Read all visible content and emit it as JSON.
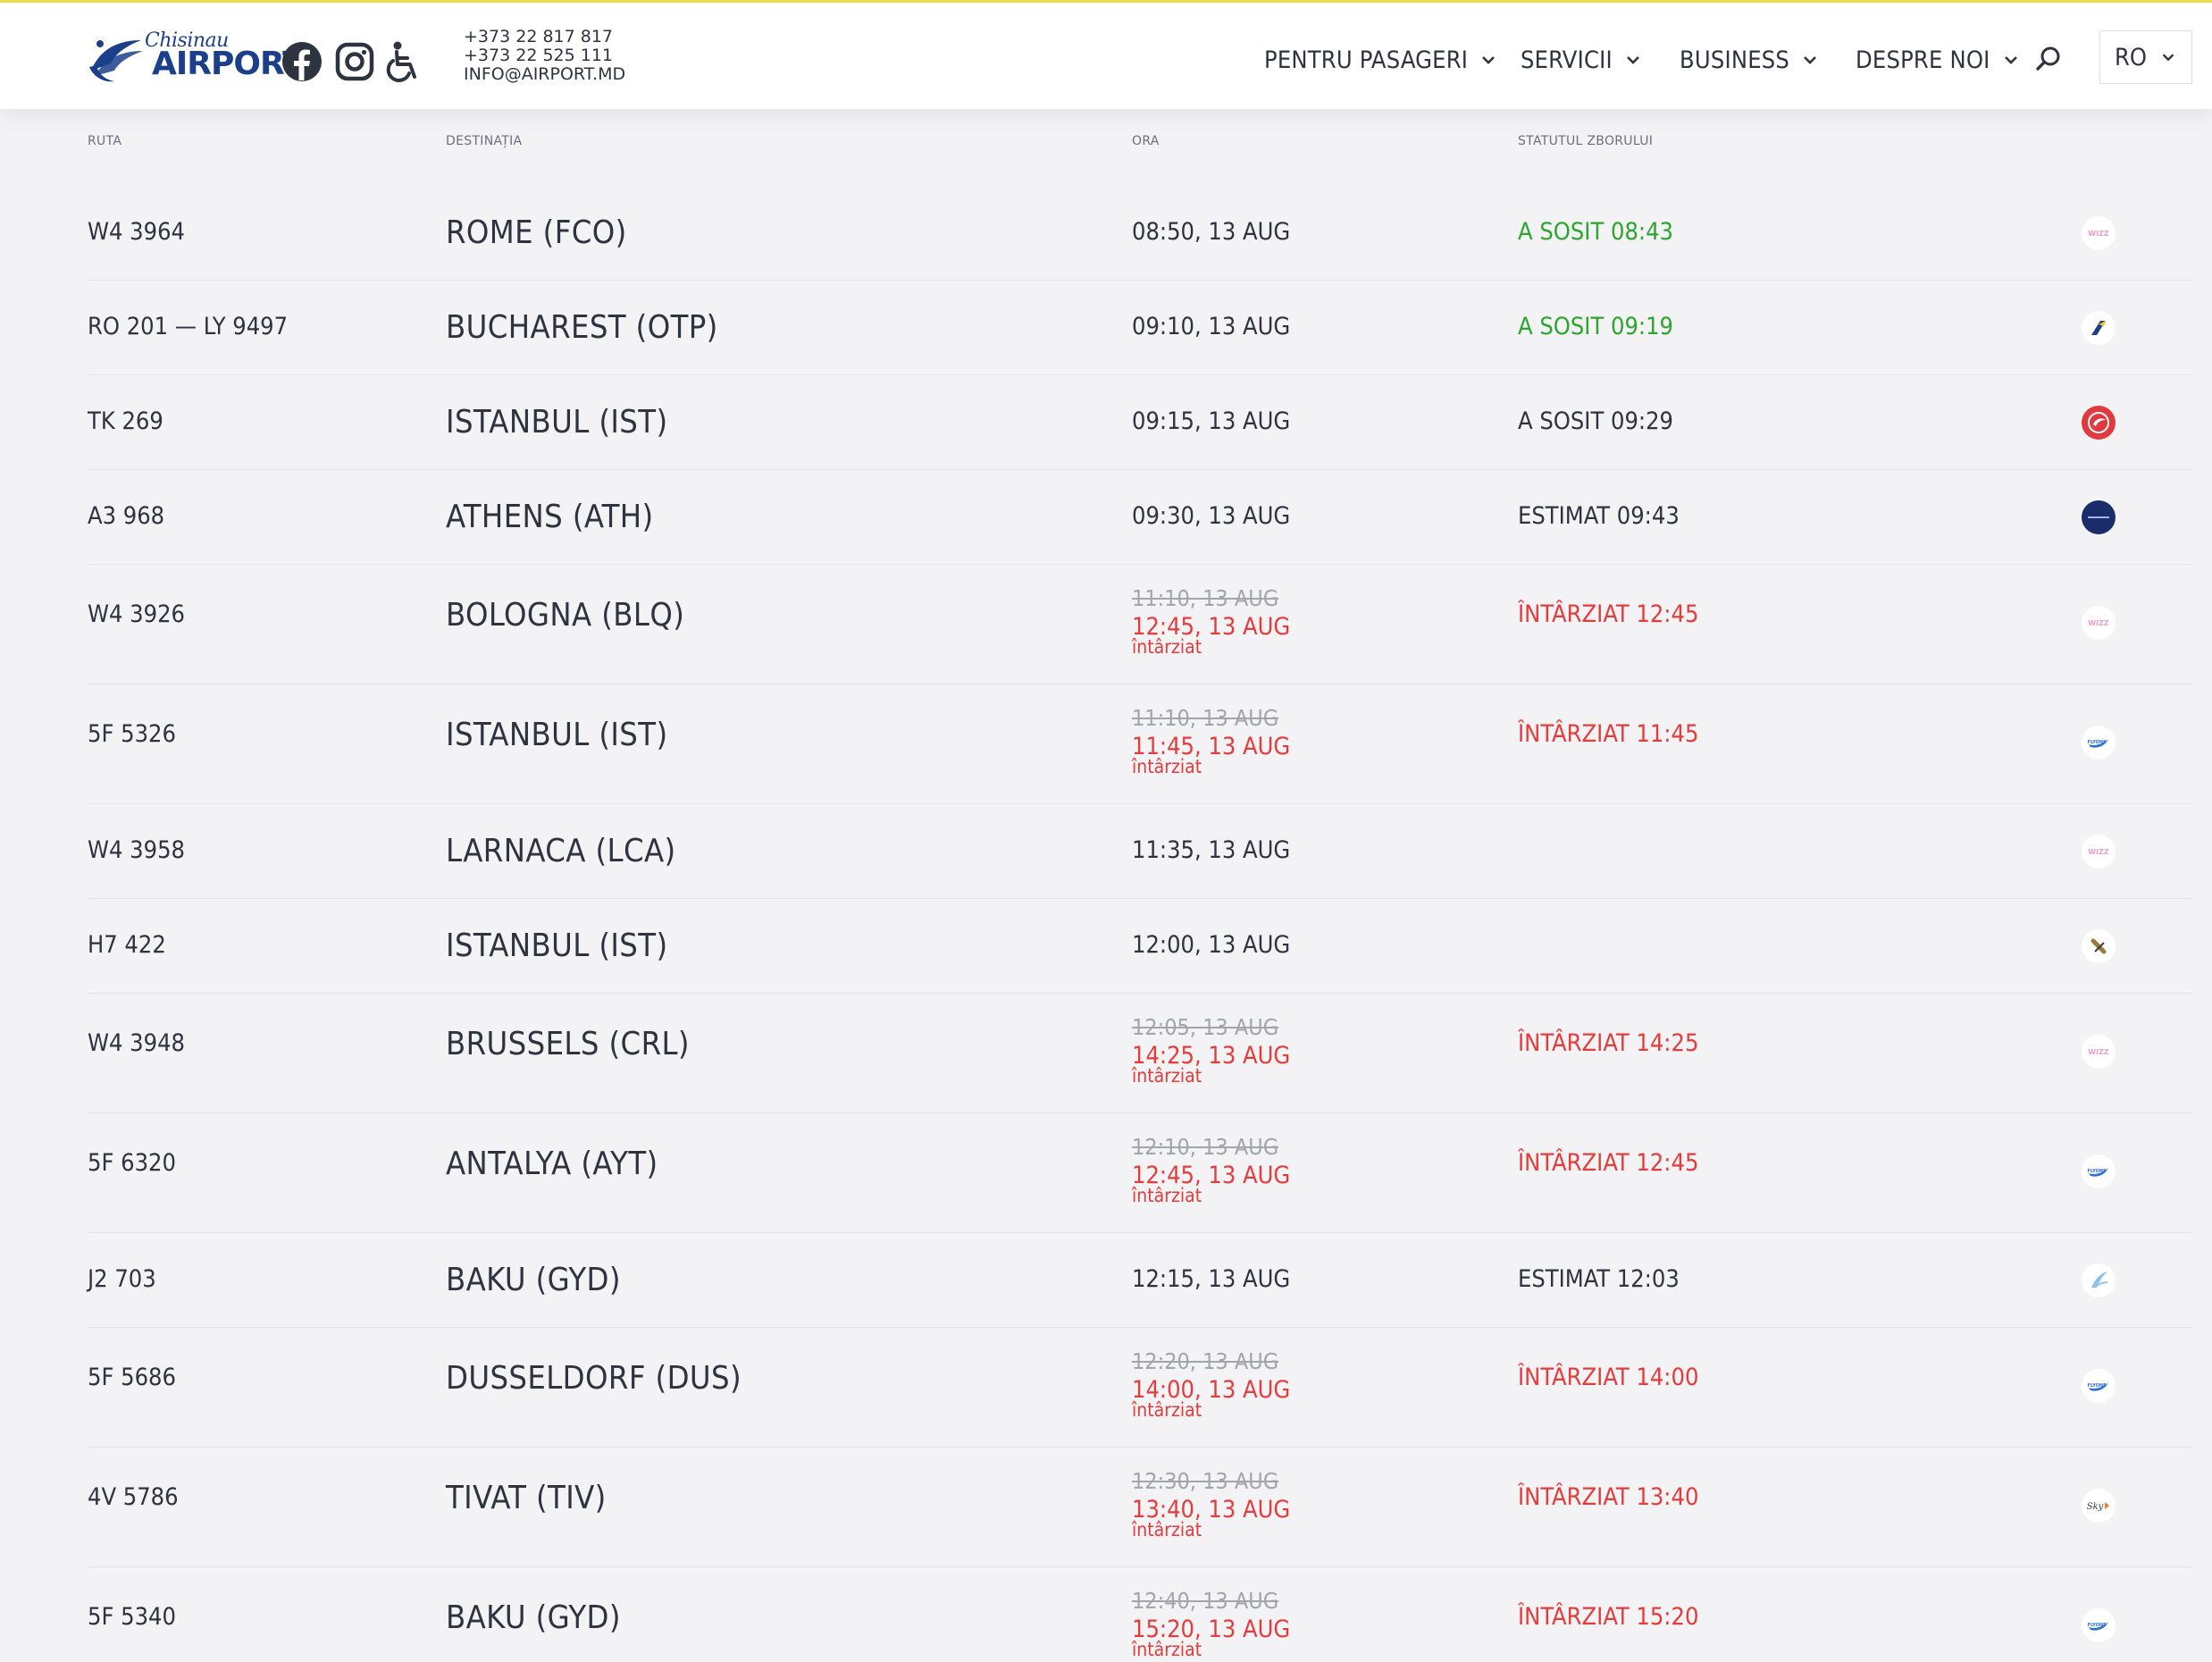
{
  "header": {
    "logo": {
      "city": "Chisinau",
      "word": "AIRPORT"
    },
    "social": {
      "facebook_icon": "facebook-icon",
      "instagram_icon": "instagram-icon",
      "accessibility_icon": "wheelchair-icon"
    },
    "contacts": {
      "phone_1": "+373 22 817 817",
      "phone_2": "+373 22 525 111",
      "email": "INFO@AIRPORT.MD"
    },
    "nav": [
      {
        "label": "PENTRU PASAGERI"
      },
      {
        "label": "SERVICII"
      },
      {
        "label": "BUSINESS"
      },
      {
        "label": "DESPRE NOI"
      }
    ],
    "search_icon": "search-icon",
    "language": "RO"
  },
  "table": {
    "columns": {
      "route": "RUTA",
      "destination": "DESTINAȚIA",
      "time": "ORA",
      "status": "STATUTUL ZBORULUI"
    },
    "rows": [
      {
        "route": "W4 3964",
        "destination": "ROME (FCO)",
        "time": "08:50, 13 AUG",
        "status": "A SOSIT 08:43",
        "status_type": "arrived",
        "airline_icon": "wizz-air-logo"
      },
      {
        "route": "RO 201 — LY 9497",
        "destination": "BUCHAREST (OTP)",
        "time": "09:10, 13 AUG",
        "status": "A SOSIT 09:19",
        "status_type": "arrived",
        "airline_icon": "tarom-logo"
      },
      {
        "route": "TK 269",
        "destination": "ISTANBUL (IST)",
        "time": "09:15, 13 AUG",
        "status": "A SOSIT 09:29",
        "status_type": "arrived-plain",
        "airline_icon": "turkish-airlines-logo"
      },
      {
        "route": "A3 968",
        "destination": "ATHENS (ATH)",
        "time": "09:30, 13 AUG",
        "status": "ESTIMAT 09:43",
        "status_type": "estimated",
        "airline_icon": "aegean-logo"
      },
      {
        "route": "W4 3926",
        "destination": "BOLOGNA (BLQ)",
        "time": "11:10, 13 AUG",
        "new_time": "12:45, 13 AUG",
        "delay_label": "întârziat",
        "status": "ÎNTÂRZIAT 12:45",
        "status_type": "delayed",
        "airline_icon": "wizz-air-logo"
      },
      {
        "route": "5F 5326",
        "destination": "ISTANBUL (IST)",
        "time": "11:10, 13 AUG",
        "new_time": "11:45, 13 AUG",
        "delay_label": "întârziat",
        "status": "ÎNTÂRZIAT 11:45",
        "status_type": "delayed",
        "airline_icon": "fly-one-logo"
      },
      {
        "route": "W4 3958",
        "destination": "LARNACA (LCA)",
        "time": "11:35, 13 AUG",
        "status": "",
        "status_type": "none",
        "airline_icon": "wizz-air-logo"
      },
      {
        "route": "H7 422",
        "destination": "ISTANBUL (IST)",
        "time": "12:00, 13 AUG",
        "status": "",
        "status_type": "none",
        "airline_icon": "hisky-logo"
      },
      {
        "route": "W4 3948",
        "destination": "BRUSSELS (CRL)",
        "time": "12:05, 13 AUG",
        "new_time": "14:25, 13 AUG",
        "delay_label": "întârziat",
        "status": "ÎNTÂRZIAT 14:25",
        "status_type": "delayed",
        "airline_icon": "wizz-air-logo"
      },
      {
        "route": "5F 6320",
        "destination": "ANTALYA (AYT)",
        "time": "12:10, 13 AUG",
        "new_time": "12:45, 13 AUG",
        "delay_label": "întârziat",
        "status": "ÎNTÂRZIAT 12:45",
        "status_type": "delayed",
        "airline_icon": "fly-one-logo"
      },
      {
        "route": "J2 703",
        "destination": "BAKU (GYD)",
        "time": "12:15, 13 AUG",
        "status": "ESTIMAT 12:03",
        "status_type": "estimated",
        "airline_icon": "azal-logo"
      },
      {
        "route": "5F 5686",
        "destination": "DUSSELDORF (DUS)",
        "time": "12:20, 13 AUG",
        "new_time": "14:00, 13 AUG",
        "delay_label": "întârziat",
        "status": "ÎNTÂRZIAT 14:00",
        "status_type": "delayed",
        "airline_icon": "fly-one-logo"
      },
      {
        "route": "4V 5786",
        "destination": "TIVAT (TIV)",
        "time": "12:30, 13 AUG",
        "new_time": "13:40, 13 AUG",
        "delay_label": "întârziat",
        "status": "ÎNTÂRZIAT 13:40",
        "status_type": "delayed",
        "airline_icon": "sky-up-logo"
      },
      {
        "route": "5F 5340",
        "destination": "BAKU (GYD)",
        "time": "12:40, 13 AUG",
        "new_time": "15:20, 13 AUG",
        "delay_label": "întârziat",
        "status": "ÎNTÂRZIAT 15:20",
        "status_type": "delayed",
        "airline_icon": "fly-one-logo"
      }
    ]
  },
  "colors": {
    "arrived": "#2ca52c",
    "delayed": "#e53b3b",
    "text": "#2e3340",
    "background": "#f3f2f5",
    "brand": "#1b3f8b",
    "accent_line": "#e7e04a"
  }
}
